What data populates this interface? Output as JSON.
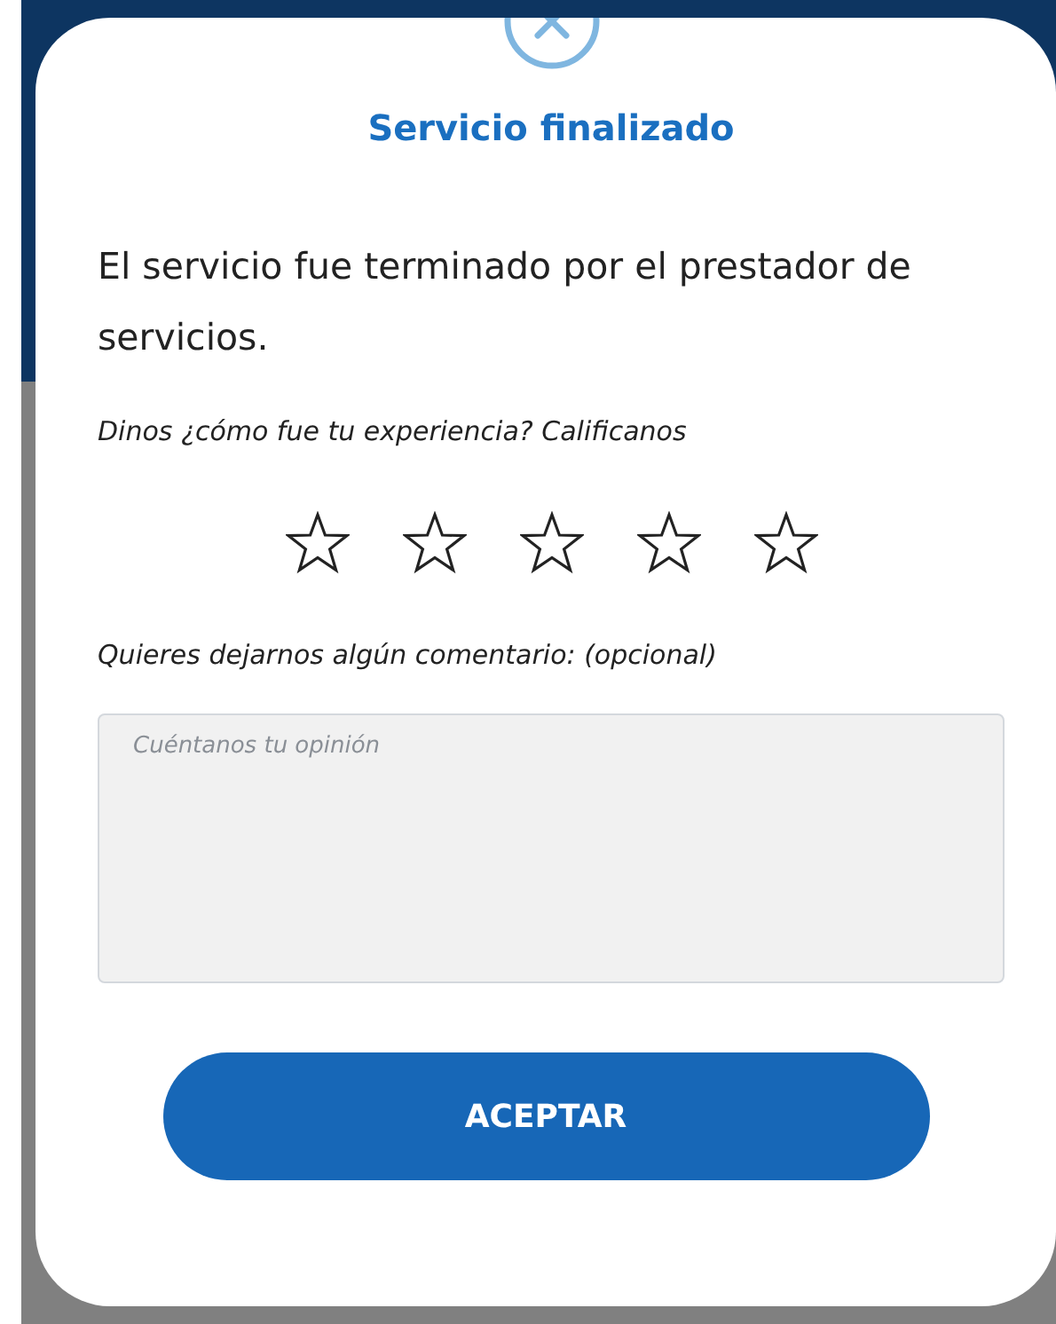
{
  "dialog": {
    "title": "Servicio finalizado",
    "message": "El servicio fue terminado por el prestador de servicios.",
    "rating_prompt": "Dinos ¿cómo fue tu experiencia? Calificanos",
    "rating": {
      "stars": 0
    },
    "comment_label": "Quieres dejarnos algún comentario: (opcional)",
    "comment": {
      "placeholder": "Cuéntanos tu opinión"
    },
    "button": "ACEPTAR"
  }
}
